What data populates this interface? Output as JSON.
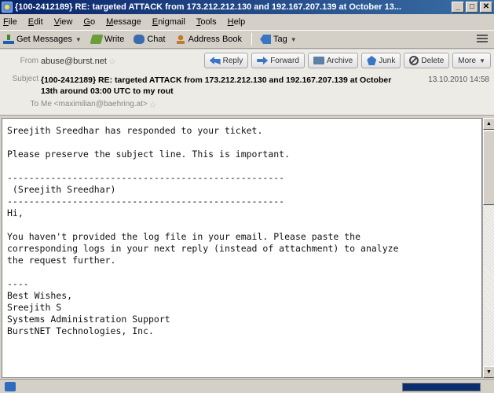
{
  "window": {
    "title": "{100-2412189} RE: targeted ATTACK from 173.212.212.130 and 192.167.207.139 at October 13...",
    "minimize": "_",
    "maximize": "□",
    "close": "✕"
  },
  "menu": [
    "File",
    "Edit",
    "View",
    "Go",
    "Message",
    "Enigmail",
    "Tools",
    "Help"
  ],
  "toolbar": {
    "get_messages": "Get Messages",
    "write": "Write",
    "chat": "Chat",
    "address_book": "Address Book",
    "tag": "Tag"
  },
  "header": {
    "from_label": "From",
    "from_value": "abuse@burst.net",
    "subject_label": "Subject",
    "subject_value": "{100-2412189} RE: targeted ATTACK from 173.212.212.130 and 192.167.207.139 at October 13th around 03:00 UTC to my rout",
    "date": "13.10.2010 14:58",
    "to_label": "To",
    "to_value": "Me <maximilian@baehring.at>",
    "actions": {
      "reply": "Reply",
      "forward": "Forward",
      "archive": "Archive",
      "junk": "Junk",
      "delete": "Delete",
      "more": "More"
    }
  },
  "body": {
    "text": "Sreejith Sreedhar has responded to your ticket.\n\nPlease preserve the subject line. This is important.\n\n---------------------------------------------------\n (Sreejith Sreedhar)\n---------------------------------------------------\nHi,\n\nYou haven't provided the log file in your email. Please paste the\ncorresponding logs in your next reply (instead of attachment) to analyze\nthe request further.\n\n----\nBest Wishes,\nSreejith S\nSystems Administration Support\nBurstNET Technologies, Inc."
  },
  "icons": {
    "app": "thunderbird-icon",
    "get": "download-icon",
    "write": "pencil-icon",
    "chat": "chat-bubble-icon",
    "address": "person-icon",
    "tag": "tag-icon"
  },
  "colors": {
    "titlebar_start": "#0a246a",
    "titlebar_end": "#3a6ea5",
    "link_blue": "#3a76c4"
  }
}
